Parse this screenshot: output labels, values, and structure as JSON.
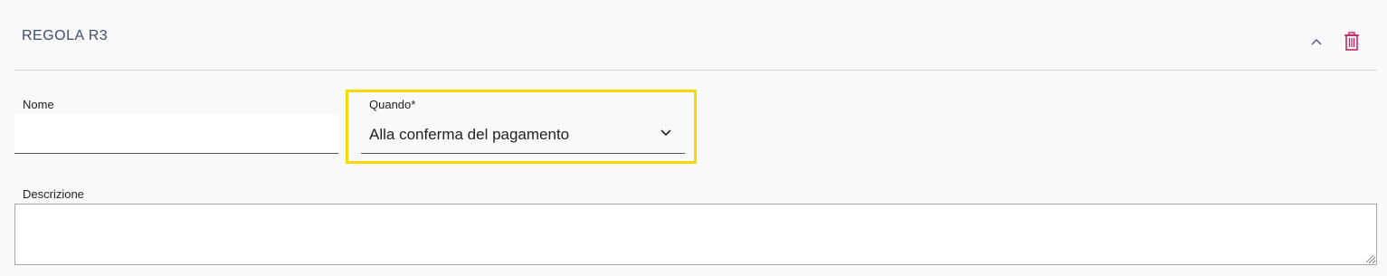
{
  "rule": {
    "title": "REGOLA R3"
  },
  "icons": {
    "collapse": "chevron-up-icon",
    "delete": "trash-icon",
    "dropdown": "chevron-down-icon"
  },
  "colors": {
    "title": "#3e4d6c",
    "delete_icon": "#c2185b",
    "highlight": "#f5da00"
  },
  "form": {
    "nome": {
      "label": "Nome",
      "value": ""
    },
    "quando": {
      "label": "Quando*",
      "value": "Alla conferma del pagamento"
    },
    "descrizione": {
      "label": "Descrizione",
      "value": ""
    }
  }
}
